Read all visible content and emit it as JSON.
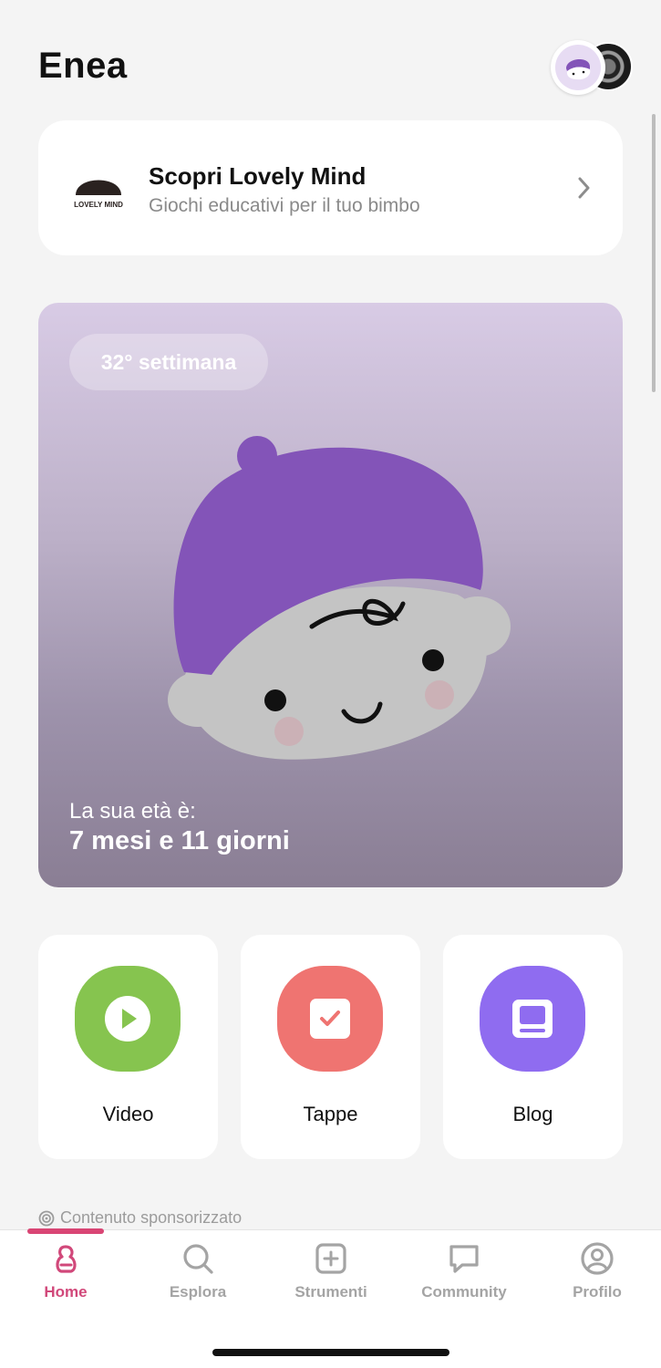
{
  "header": {
    "title": "Enea"
  },
  "promo": {
    "logo_text": "LOVELY MIND",
    "title": "Scopri Lovely Mind",
    "subtitle": "Giochi educativi per il tuo bimbo"
  },
  "hero": {
    "week_label": "32° settimana",
    "age_label": "La sua età è:",
    "age_value": "7 mesi e 11 giorni"
  },
  "tiles": [
    {
      "label": "Video",
      "icon": "play-icon",
      "color": "#86c44f"
    },
    {
      "label": "Tappe",
      "icon": "checklist-icon",
      "color": "#ef7471"
    },
    {
      "label": "Blog",
      "icon": "book-icon",
      "color": "#8f6cf0"
    }
  ],
  "sponsored": {
    "label": "Contenuto sponsorizzato"
  },
  "nav": {
    "items": [
      {
        "label": "Home",
        "icon": "home-icon",
        "active": true
      },
      {
        "label": "Esplora",
        "icon": "search-icon",
        "active": false
      },
      {
        "label": "Strumenti",
        "icon": "plus-box-icon",
        "active": false
      },
      {
        "label": "Community",
        "icon": "chat-icon",
        "active": false
      },
      {
        "label": "Profilo",
        "icon": "profile-icon",
        "active": false
      }
    ]
  },
  "colors": {
    "accent": "#d1487a",
    "hat": "#8354b8",
    "background": "#f4f4f4"
  }
}
